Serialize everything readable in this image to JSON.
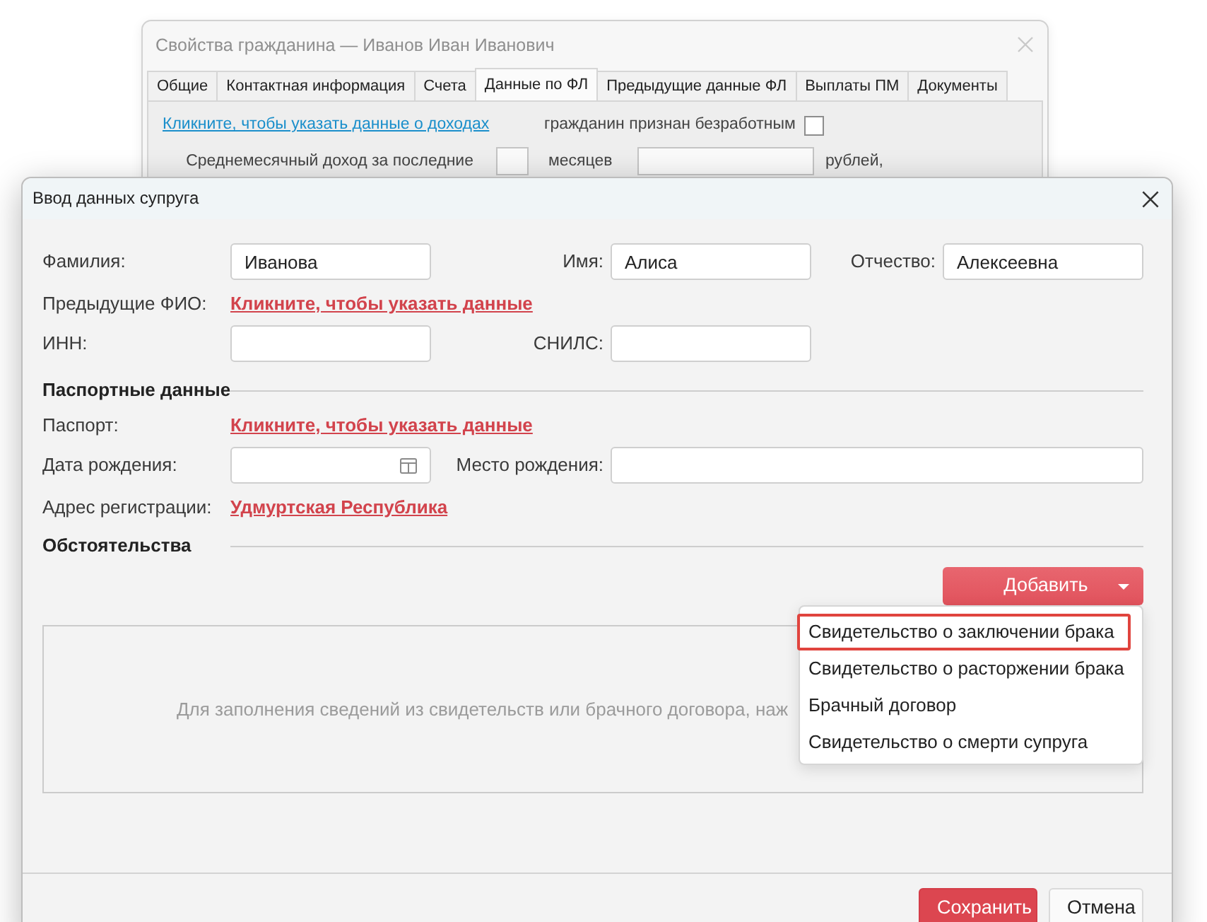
{
  "background_window": {
    "title": "Свойства гражданина — Иванов Иван Иванович",
    "tabs": [
      {
        "label": "Общие",
        "selected": false
      },
      {
        "label": "Контактная информация",
        "selected": false
      },
      {
        "label": "Счета",
        "selected": false
      },
      {
        "label": "Данные по ФЛ",
        "selected": true
      },
      {
        "label": "Предыдущие данные ФЛ",
        "selected": false
      },
      {
        "label": "Выплаты ПМ",
        "selected": false
      },
      {
        "label": "Документы",
        "selected": false
      }
    ],
    "income_link": "Кликните, чтобы указать данные о доходах",
    "unemployed": {
      "label": "гражданин признан безработным",
      "checked": false
    },
    "average_income": {
      "label": "Среднемесячный доход за последние",
      "months_label": "месяцев",
      "currency_label": "рублей,"
    }
  },
  "dialog": {
    "title": "Ввод данных супруга",
    "last_name": {
      "label": "Фамилия:",
      "value": "Иванова"
    },
    "first_name": {
      "label": "Имя:",
      "value": "Алиса"
    },
    "patronymic": {
      "label": "Отчество:",
      "value": "Алексеевна"
    },
    "previous_names": {
      "label": "Предыдущие ФИО:",
      "link": "Кликните, чтобы указать данные"
    },
    "inn": {
      "label": "ИНН:"
    },
    "snils": {
      "label": "СНИЛС:"
    },
    "passport_section": {
      "title": "Паспортные данные",
      "passport": {
        "label": "Паспорт:",
        "link": "Кликните, чтобы указать данные"
      },
      "birth_date": {
        "label": "Дата рождения:"
      },
      "birth_place": {
        "label": "Место рождения:"
      },
      "registration_address": {
        "label": "Адрес регистрации:",
        "link": "Удмуртская Республика"
      }
    },
    "circumstances_section": {
      "title": "Обстоятельства",
      "add_button": "Добавить",
      "add_menu": [
        {
          "label": "Свидетельство о заключении брака",
          "selected": true
        },
        {
          "label": "Свидетельство о расторжении брака",
          "selected": false
        },
        {
          "label": "Брачный договор",
          "selected": false
        },
        {
          "label": "Свидетельство о смерти супруга",
          "selected": false
        }
      ],
      "empty_hint": "Для заполнения сведений из свидетельств или брачного договора, наж"
    },
    "buttons": [
      {
        "label": "Сохранить",
        "kind": "primary"
      },
      {
        "label": "Отмена",
        "kind": "secondary"
      }
    ]
  }
}
